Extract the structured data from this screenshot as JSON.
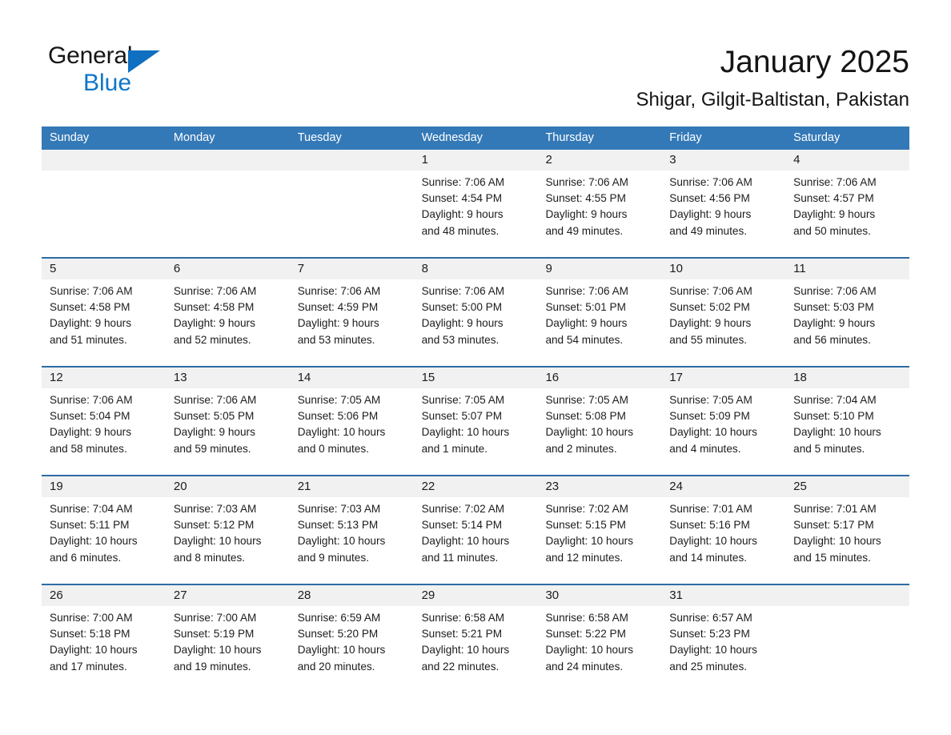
{
  "brand": {
    "name_part1": "General",
    "name_part2": "Blue",
    "triangle_color": "#0f6fc0",
    "blue_color": "#0f76c8"
  },
  "header": {
    "title": "January 2025",
    "location": "Shigar, Gilgit-Baltistan, Pakistan"
  },
  "theme": {
    "header_bg": "#3479b7",
    "header_text": "#ffffff",
    "separator": "#2e6ca4",
    "date_band": "#f1f1f1",
    "cell_bg": "#ffffff",
    "text": "#1c1c1c"
  },
  "calendar": {
    "weekday_headers": [
      "Sunday",
      "Monday",
      "Tuesday",
      "Wednesday",
      "Thursday",
      "Friday",
      "Saturday"
    ],
    "weeks": [
      [
        {
          "date": "",
          "sunrise": "",
          "sunset": "",
          "daylight_line1": "",
          "daylight_line2": ""
        },
        {
          "date": "",
          "sunrise": "",
          "sunset": "",
          "daylight_line1": "",
          "daylight_line2": ""
        },
        {
          "date": "",
          "sunrise": "",
          "sunset": "",
          "daylight_line1": "",
          "daylight_line2": ""
        },
        {
          "date": "1",
          "sunrise": "Sunrise: 7:06 AM",
          "sunset": "Sunset: 4:54 PM",
          "daylight_line1": "Daylight: 9 hours",
          "daylight_line2": "and 48 minutes."
        },
        {
          "date": "2",
          "sunrise": "Sunrise: 7:06 AM",
          "sunset": "Sunset: 4:55 PM",
          "daylight_line1": "Daylight: 9 hours",
          "daylight_line2": "and 49 minutes."
        },
        {
          "date": "3",
          "sunrise": "Sunrise: 7:06 AM",
          "sunset": "Sunset: 4:56 PM",
          "daylight_line1": "Daylight: 9 hours",
          "daylight_line2": "and 49 minutes."
        },
        {
          "date": "4",
          "sunrise": "Sunrise: 7:06 AM",
          "sunset": "Sunset: 4:57 PM",
          "daylight_line1": "Daylight: 9 hours",
          "daylight_line2": "and 50 minutes."
        }
      ],
      [
        {
          "date": "5",
          "sunrise": "Sunrise: 7:06 AM",
          "sunset": "Sunset: 4:58 PM",
          "daylight_line1": "Daylight: 9 hours",
          "daylight_line2": "and 51 minutes."
        },
        {
          "date": "6",
          "sunrise": "Sunrise: 7:06 AM",
          "sunset": "Sunset: 4:58 PM",
          "daylight_line1": "Daylight: 9 hours",
          "daylight_line2": "and 52 minutes."
        },
        {
          "date": "7",
          "sunrise": "Sunrise: 7:06 AM",
          "sunset": "Sunset: 4:59 PM",
          "daylight_line1": "Daylight: 9 hours",
          "daylight_line2": "and 53 minutes."
        },
        {
          "date": "8",
          "sunrise": "Sunrise: 7:06 AM",
          "sunset": "Sunset: 5:00 PM",
          "daylight_line1": "Daylight: 9 hours",
          "daylight_line2": "and 53 minutes."
        },
        {
          "date": "9",
          "sunrise": "Sunrise: 7:06 AM",
          "sunset": "Sunset: 5:01 PM",
          "daylight_line1": "Daylight: 9 hours",
          "daylight_line2": "and 54 minutes."
        },
        {
          "date": "10",
          "sunrise": "Sunrise: 7:06 AM",
          "sunset": "Sunset: 5:02 PM",
          "daylight_line1": "Daylight: 9 hours",
          "daylight_line2": "and 55 minutes."
        },
        {
          "date": "11",
          "sunrise": "Sunrise: 7:06 AM",
          "sunset": "Sunset: 5:03 PM",
          "daylight_line1": "Daylight: 9 hours",
          "daylight_line2": "and 56 minutes."
        }
      ],
      [
        {
          "date": "12",
          "sunrise": "Sunrise: 7:06 AM",
          "sunset": "Sunset: 5:04 PM",
          "daylight_line1": "Daylight: 9 hours",
          "daylight_line2": "and 58 minutes."
        },
        {
          "date": "13",
          "sunrise": "Sunrise: 7:06 AM",
          "sunset": "Sunset: 5:05 PM",
          "daylight_line1": "Daylight: 9 hours",
          "daylight_line2": "and 59 minutes."
        },
        {
          "date": "14",
          "sunrise": "Sunrise: 7:05 AM",
          "sunset": "Sunset: 5:06 PM",
          "daylight_line1": "Daylight: 10 hours",
          "daylight_line2": "and 0 minutes."
        },
        {
          "date": "15",
          "sunrise": "Sunrise: 7:05 AM",
          "sunset": "Sunset: 5:07 PM",
          "daylight_line1": "Daylight: 10 hours",
          "daylight_line2": "and 1 minute."
        },
        {
          "date": "16",
          "sunrise": "Sunrise: 7:05 AM",
          "sunset": "Sunset: 5:08 PM",
          "daylight_line1": "Daylight: 10 hours",
          "daylight_line2": "and 2 minutes."
        },
        {
          "date": "17",
          "sunrise": "Sunrise: 7:05 AM",
          "sunset": "Sunset: 5:09 PM",
          "daylight_line1": "Daylight: 10 hours",
          "daylight_line2": "and 4 minutes."
        },
        {
          "date": "18",
          "sunrise": "Sunrise: 7:04 AM",
          "sunset": "Sunset: 5:10 PM",
          "daylight_line1": "Daylight: 10 hours",
          "daylight_line2": "and 5 minutes."
        }
      ],
      [
        {
          "date": "19",
          "sunrise": "Sunrise: 7:04 AM",
          "sunset": "Sunset: 5:11 PM",
          "daylight_line1": "Daylight: 10 hours",
          "daylight_line2": "and 6 minutes."
        },
        {
          "date": "20",
          "sunrise": "Sunrise: 7:03 AM",
          "sunset": "Sunset: 5:12 PM",
          "daylight_line1": "Daylight: 10 hours",
          "daylight_line2": "and 8 minutes."
        },
        {
          "date": "21",
          "sunrise": "Sunrise: 7:03 AM",
          "sunset": "Sunset: 5:13 PM",
          "daylight_line1": "Daylight: 10 hours",
          "daylight_line2": "and 9 minutes."
        },
        {
          "date": "22",
          "sunrise": "Sunrise: 7:02 AM",
          "sunset": "Sunset: 5:14 PM",
          "daylight_line1": "Daylight: 10 hours",
          "daylight_line2": "and 11 minutes."
        },
        {
          "date": "23",
          "sunrise": "Sunrise: 7:02 AM",
          "sunset": "Sunset: 5:15 PM",
          "daylight_line1": "Daylight: 10 hours",
          "daylight_line2": "and 12 minutes."
        },
        {
          "date": "24",
          "sunrise": "Sunrise: 7:01 AM",
          "sunset": "Sunset: 5:16 PM",
          "daylight_line1": "Daylight: 10 hours",
          "daylight_line2": "and 14 minutes."
        },
        {
          "date": "25",
          "sunrise": "Sunrise: 7:01 AM",
          "sunset": "Sunset: 5:17 PM",
          "daylight_line1": "Daylight: 10 hours",
          "daylight_line2": "and 15 minutes."
        }
      ],
      [
        {
          "date": "26",
          "sunrise": "Sunrise: 7:00 AM",
          "sunset": "Sunset: 5:18 PM",
          "daylight_line1": "Daylight: 10 hours",
          "daylight_line2": "and 17 minutes."
        },
        {
          "date": "27",
          "sunrise": "Sunrise: 7:00 AM",
          "sunset": "Sunset: 5:19 PM",
          "daylight_line1": "Daylight: 10 hours",
          "daylight_line2": "and 19 minutes."
        },
        {
          "date": "28",
          "sunrise": "Sunrise: 6:59 AM",
          "sunset": "Sunset: 5:20 PM",
          "daylight_line1": "Daylight: 10 hours",
          "daylight_line2": "and 20 minutes."
        },
        {
          "date": "29",
          "sunrise": "Sunrise: 6:58 AM",
          "sunset": "Sunset: 5:21 PM",
          "daylight_line1": "Daylight: 10 hours",
          "daylight_line2": "and 22 minutes."
        },
        {
          "date": "30",
          "sunrise": "Sunrise: 6:58 AM",
          "sunset": "Sunset: 5:22 PM",
          "daylight_line1": "Daylight: 10 hours",
          "daylight_line2": "and 24 minutes."
        },
        {
          "date": "31",
          "sunrise": "Sunrise: 6:57 AM",
          "sunset": "Sunset: 5:23 PM",
          "daylight_line1": "Daylight: 10 hours",
          "daylight_line2": "and 25 minutes."
        },
        {
          "date": "",
          "sunrise": "",
          "sunset": "",
          "daylight_line1": "",
          "daylight_line2": ""
        }
      ]
    ]
  }
}
